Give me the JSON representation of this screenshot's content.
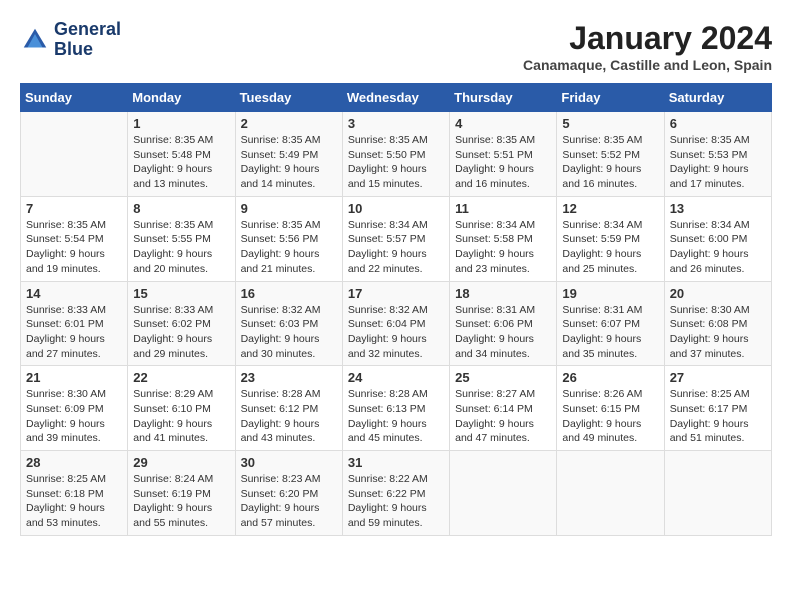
{
  "logo": {
    "line1": "General",
    "line2": "Blue"
  },
  "title": "January 2024",
  "subtitle": "Canamaque, Castille and Leon, Spain",
  "weekdays": [
    "Sunday",
    "Monday",
    "Tuesday",
    "Wednesday",
    "Thursday",
    "Friday",
    "Saturday"
  ],
  "weeks": [
    [
      {
        "day": "",
        "info": ""
      },
      {
        "day": "1",
        "info": "Sunrise: 8:35 AM\nSunset: 5:48 PM\nDaylight: 9 hours\nand 13 minutes."
      },
      {
        "day": "2",
        "info": "Sunrise: 8:35 AM\nSunset: 5:49 PM\nDaylight: 9 hours\nand 14 minutes."
      },
      {
        "day": "3",
        "info": "Sunrise: 8:35 AM\nSunset: 5:50 PM\nDaylight: 9 hours\nand 15 minutes."
      },
      {
        "day": "4",
        "info": "Sunrise: 8:35 AM\nSunset: 5:51 PM\nDaylight: 9 hours\nand 16 minutes."
      },
      {
        "day": "5",
        "info": "Sunrise: 8:35 AM\nSunset: 5:52 PM\nDaylight: 9 hours\nand 16 minutes."
      },
      {
        "day": "6",
        "info": "Sunrise: 8:35 AM\nSunset: 5:53 PM\nDaylight: 9 hours\nand 17 minutes."
      }
    ],
    [
      {
        "day": "7",
        "info": "Sunrise: 8:35 AM\nSunset: 5:54 PM\nDaylight: 9 hours\nand 19 minutes."
      },
      {
        "day": "8",
        "info": "Sunrise: 8:35 AM\nSunset: 5:55 PM\nDaylight: 9 hours\nand 20 minutes."
      },
      {
        "day": "9",
        "info": "Sunrise: 8:35 AM\nSunset: 5:56 PM\nDaylight: 9 hours\nand 21 minutes."
      },
      {
        "day": "10",
        "info": "Sunrise: 8:34 AM\nSunset: 5:57 PM\nDaylight: 9 hours\nand 22 minutes."
      },
      {
        "day": "11",
        "info": "Sunrise: 8:34 AM\nSunset: 5:58 PM\nDaylight: 9 hours\nand 23 minutes."
      },
      {
        "day": "12",
        "info": "Sunrise: 8:34 AM\nSunset: 5:59 PM\nDaylight: 9 hours\nand 25 minutes."
      },
      {
        "day": "13",
        "info": "Sunrise: 8:34 AM\nSunset: 6:00 PM\nDaylight: 9 hours\nand 26 minutes."
      }
    ],
    [
      {
        "day": "14",
        "info": "Sunrise: 8:33 AM\nSunset: 6:01 PM\nDaylight: 9 hours\nand 27 minutes."
      },
      {
        "day": "15",
        "info": "Sunrise: 8:33 AM\nSunset: 6:02 PM\nDaylight: 9 hours\nand 29 minutes."
      },
      {
        "day": "16",
        "info": "Sunrise: 8:32 AM\nSunset: 6:03 PM\nDaylight: 9 hours\nand 30 minutes."
      },
      {
        "day": "17",
        "info": "Sunrise: 8:32 AM\nSunset: 6:04 PM\nDaylight: 9 hours\nand 32 minutes."
      },
      {
        "day": "18",
        "info": "Sunrise: 8:31 AM\nSunset: 6:06 PM\nDaylight: 9 hours\nand 34 minutes."
      },
      {
        "day": "19",
        "info": "Sunrise: 8:31 AM\nSunset: 6:07 PM\nDaylight: 9 hours\nand 35 minutes."
      },
      {
        "day": "20",
        "info": "Sunrise: 8:30 AM\nSunset: 6:08 PM\nDaylight: 9 hours\nand 37 minutes."
      }
    ],
    [
      {
        "day": "21",
        "info": "Sunrise: 8:30 AM\nSunset: 6:09 PM\nDaylight: 9 hours\nand 39 minutes."
      },
      {
        "day": "22",
        "info": "Sunrise: 8:29 AM\nSunset: 6:10 PM\nDaylight: 9 hours\nand 41 minutes."
      },
      {
        "day": "23",
        "info": "Sunrise: 8:28 AM\nSunset: 6:12 PM\nDaylight: 9 hours\nand 43 minutes."
      },
      {
        "day": "24",
        "info": "Sunrise: 8:28 AM\nSunset: 6:13 PM\nDaylight: 9 hours\nand 45 minutes."
      },
      {
        "day": "25",
        "info": "Sunrise: 8:27 AM\nSunset: 6:14 PM\nDaylight: 9 hours\nand 47 minutes."
      },
      {
        "day": "26",
        "info": "Sunrise: 8:26 AM\nSunset: 6:15 PM\nDaylight: 9 hours\nand 49 minutes."
      },
      {
        "day": "27",
        "info": "Sunrise: 8:25 AM\nSunset: 6:17 PM\nDaylight: 9 hours\nand 51 minutes."
      }
    ],
    [
      {
        "day": "28",
        "info": "Sunrise: 8:25 AM\nSunset: 6:18 PM\nDaylight: 9 hours\nand 53 minutes."
      },
      {
        "day": "29",
        "info": "Sunrise: 8:24 AM\nSunset: 6:19 PM\nDaylight: 9 hours\nand 55 minutes."
      },
      {
        "day": "30",
        "info": "Sunrise: 8:23 AM\nSunset: 6:20 PM\nDaylight: 9 hours\nand 57 minutes."
      },
      {
        "day": "31",
        "info": "Sunrise: 8:22 AM\nSunset: 6:22 PM\nDaylight: 9 hours\nand 59 minutes."
      },
      {
        "day": "",
        "info": ""
      },
      {
        "day": "",
        "info": ""
      },
      {
        "day": "",
        "info": ""
      }
    ]
  ]
}
